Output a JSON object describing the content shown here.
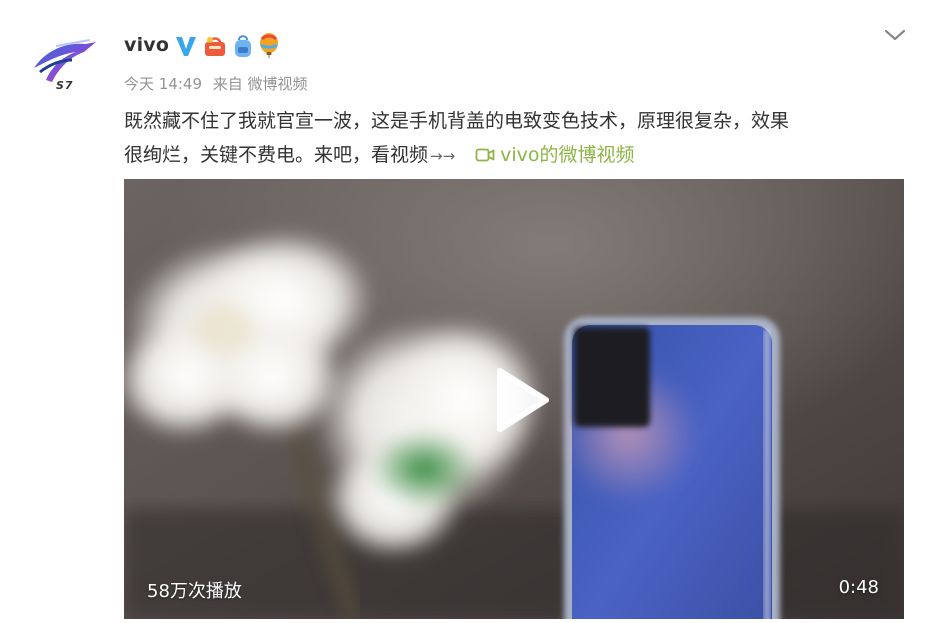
{
  "post": {
    "username": "vivo",
    "avatar_label": "S7",
    "badges": [
      "verified-v-icon",
      "shopping-bag-icon",
      "backpack-icon",
      "balloon-icon"
    ],
    "meta": {
      "time": "今天 14:49",
      "source": "来自 微博视频"
    },
    "text_line1": "既然藏不住了我就官宣一波，这是手机背盖的电致变色技术，原理很复杂，效果",
    "text_line2": "很绚烂，关键不费电。来吧，看视频",
    "arrow_emoji": "→→",
    "video_link_label": "vivo的微博视频",
    "colors": {
      "link": "#8db545",
      "verified": "#3aa6ea",
      "meta": "#939393"
    }
  },
  "video": {
    "views": "58万次播放",
    "duration": "0:48"
  }
}
